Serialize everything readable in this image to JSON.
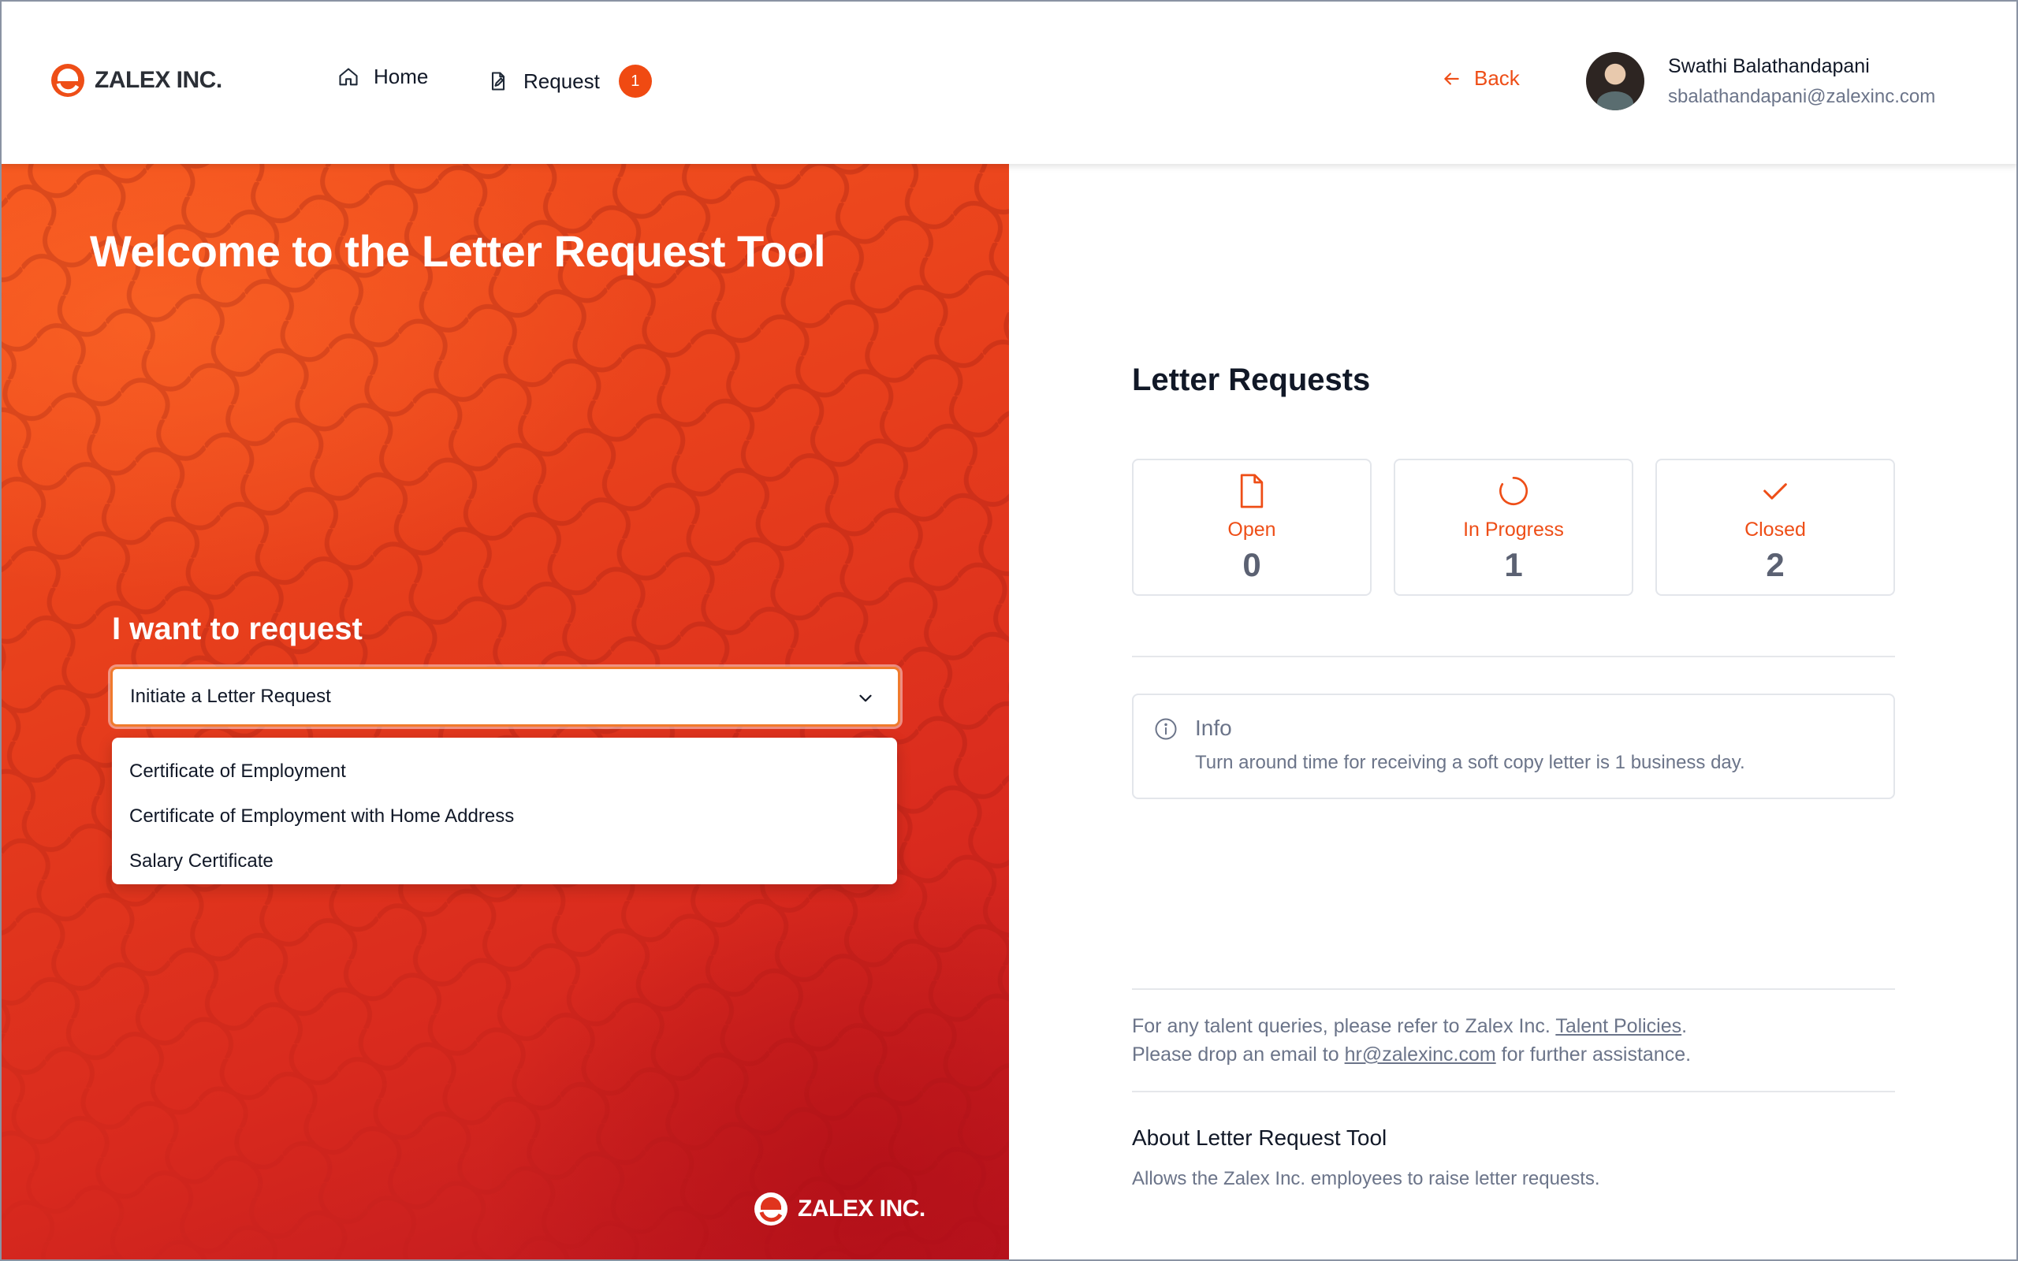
{
  "brand": {
    "name": "ZALEX INC.",
    "accent": "#ee4e17",
    "logo_icon": "zalex-logo-icon"
  },
  "header": {
    "nav": [
      {
        "label": "Home",
        "icon": "home-icon"
      },
      {
        "label": "Request",
        "icon": "document-edit-icon",
        "badge": "1"
      }
    ],
    "back_label": "Back",
    "user": {
      "name": "Swathi Balathandapani",
      "email": "sbalathandapani@zalexinc.com"
    }
  },
  "hero": {
    "title": "Welcome to the Letter Request Tool",
    "request_label": "I want to request",
    "select": {
      "value": "Initiate a Letter Request"
    },
    "options": [
      "Certificate of Employment",
      "Certificate of Employment with Home Address",
      "Salary Certificate"
    ],
    "footer_logo_text": "ZALEX INC."
  },
  "requests": {
    "title": "Letter Requests",
    "cards": [
      {
        "label": "Open",
        "count": "0",
        "icon": "file-icon"
      },
      {
        "label": "In Progress",
        "count": "1",
        "icon": "spinner-icon"
      },
      {
        "label": "Closed",
        "count": "2",
        "icon": "check-icon"
      }
    ]
  },
  "info": {
    "title": "Info",
    "text": "Turn around time for receiving a soft copy letter is 1 business day."
  },
  "footer": {
    "line1_prefix": "For any talent queries, please refer to Zalex Inc. ",
    "line1_link": "Talent Policies",
    "line1_suffix": ".",
    "line2_prefix": "Please drop an email to ",
    "line2_link": "hr@zalexinc.com",
    "line2_suffix": " for further assistance.",
    "about_title": "About Letter Request Tool",
    "about_text": "Allows the Zalex Inc. employees to raise letter requests."
  }
}
